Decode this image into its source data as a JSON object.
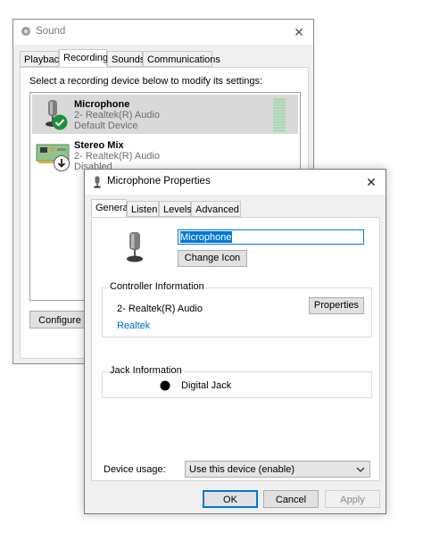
{
  "sound_dialog": {
    "title": "Sound",
    "close_glyph": "✕",
    "tabs": [
      "Playback",
      "Recording",
      "Sounds",
      "Communications"
    ],
    "active_tab": "Recording",
    "instruction": "Select a recording device below to modify its settings:",
    "devices": [
      {
        "name": "Microphone",
        "driver": "2- Realtek(R) Audio",
        "status": "Default Device",
        "icon": "microphone-icon",
        "badge": "checkmark-icon",
        "selected": true
      },
      {
        "name": "Stereo Mix",
        "driver": "2- Realtek(R) Audio",
        "status": "Disabled",
        "icon": "sound-card-icon",
        "badge": "down-arrow-icon",
        "selected": false
      }
    ],
    "configure_label": "Configure"
  },
  "properties_dialog": {
    "title": "Microphone Properties",
    "close_glyph": "✕",
    "tabs": [
      "General",
      "Listen",
      "Levels",
      "Advanced"
    ],
    "active_tab": "General",
    "device_name_value": "Microphone",
    "change_icon_label": "Change Icon",
    "controller": {
      "group_label": "Controller Information",
      "name": "2- Realtek(R) Audio",
      "link": "Realtek",
      "properties_label": "Properties"
    },
    "jack": {
      "group_label": "Jack Information",
      "value": "Digital Jack"
    },
    "device_usage": {
      "label": "Device usage:",
      "selected": "Use this device (enable)"
    },
    "buttons": {
      "ok": "OK",
      "cancel": "Cancel",
      "apply": "Apply"
    }
  },
  "colors": {
    "accent": "#0078d7",
    "selection": "#d9d9d9",
    "link": "#0066cc",
    "check_green": "#1e8f3a"
  }
}
